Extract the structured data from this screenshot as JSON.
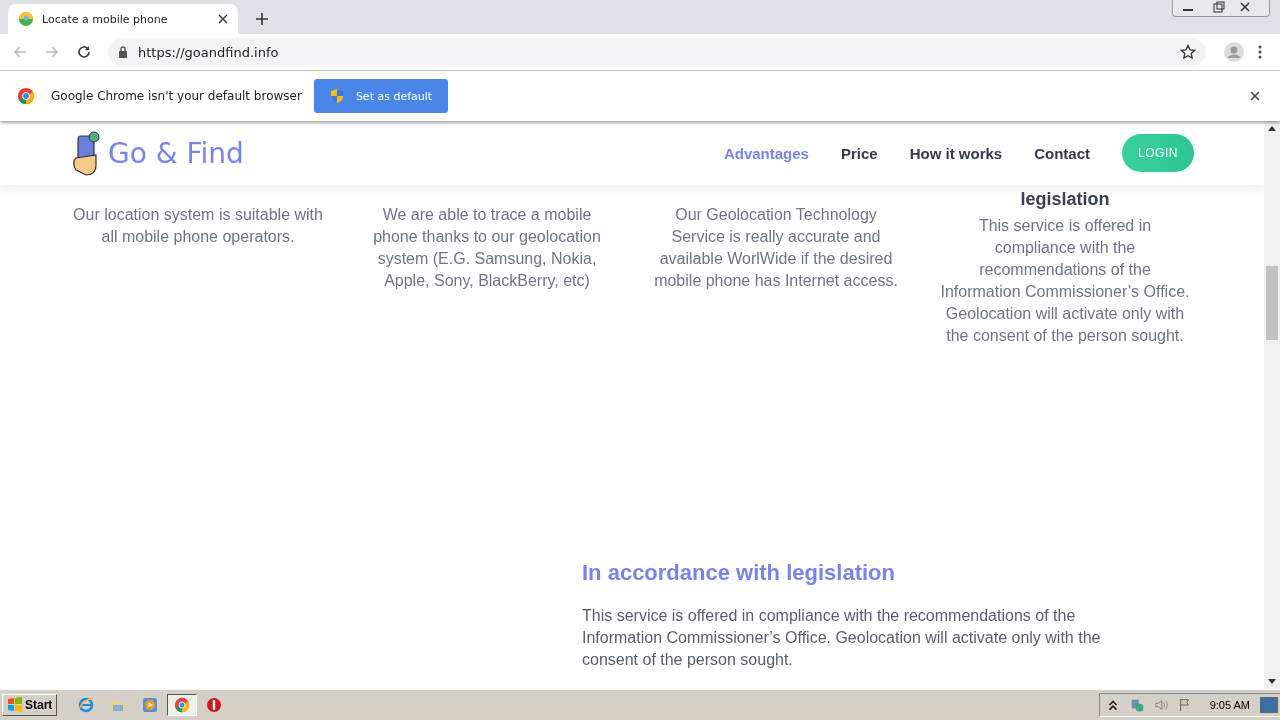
{
  "browser": {
    "tab_title": "Locate a mobile phone",
    "url": "https://goandfind.info"
  },
  "infobar": {
    "message": "Google Chrome isn't your default browser",
    "button": "Set as default"
  },
  "site": {
    "logo": "Go & Find",
    "nav": [
      {
        "label": "Advantages",
        "selected": true
      },
      {
        "label": "Price",
        "selected": false
      },
      {
        "label": "How it works",
        "selected": false
      },
      {
        "label": "Contact",
        "selected": false
      }
    ],
    "login": "LOGIN",
    "features": [
      {
        "text": "Our location system is suitable with all mobile phone operators."
      },
      {
        "text": "We are able to trace a mobile phone thanks to our geolocation system (E.G. Samsung, Nokia, Apple, Sony, BlackBerry, etc)"
      },
      {
        "text": "Our Geolocation Technology Service is really accurate and available WorlWide if the desired mobile phone has Internet access."
      },
      {
        "heading": "legislation",
        "text": "This service is offered in compliance with the recommendations of the Information Commissioner’s Office. Geolocation will activate only with the consent of the person sought."
      }
    ],
    "section": {
      "title": "In accordance with legislation",
      "text": "This service is offered in compliance with the recommendations of the Information Commissioner’s Office. Geolocation will activate only with the consent of the person sought."
    }
  },
  "taskbar": {
    "start": "Start",
    "apps": [
      {
        "kind": "ie",
        "active": false
      },
      {
        "kind": "folder",
        "active": false
      },
      {
        "kind": "media",
        "active": false
      },
      {
        "kind": "chrome",
        "active": true
      },
      {
        "kind": "stop",
        "active": false
      }
    ],
    "clock": "9:05 AM"
  }
}
